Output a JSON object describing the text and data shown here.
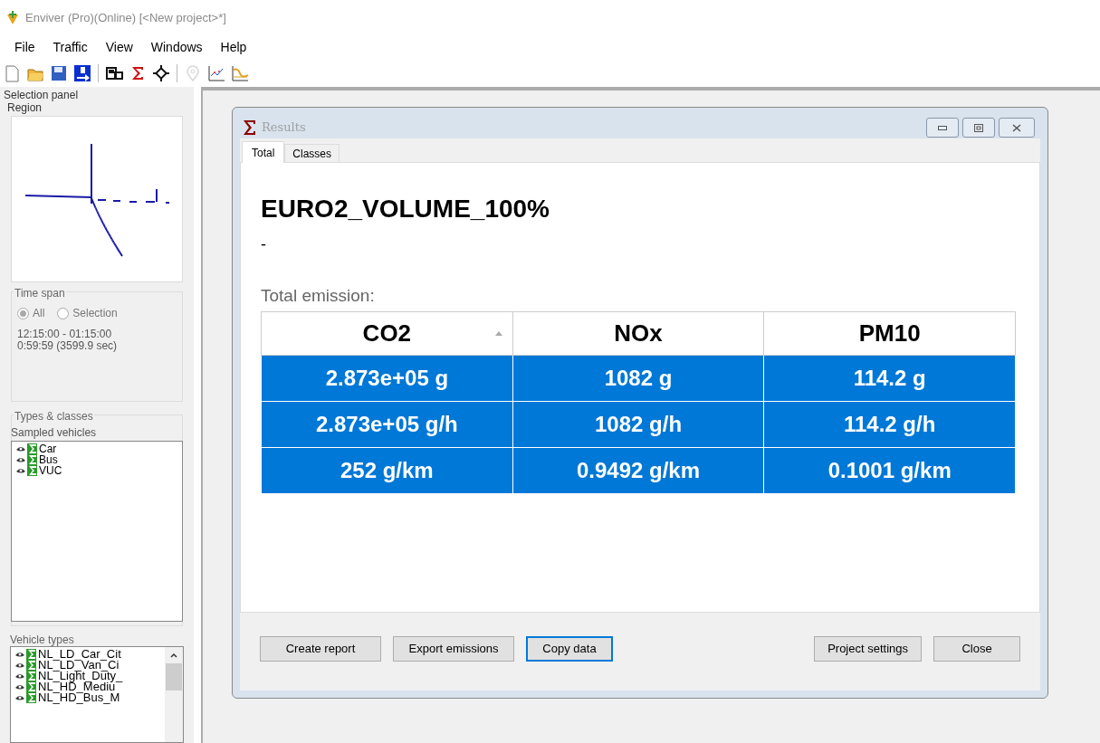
{
  "window": {
    "title": "Enviver (Pro)(Online) [<New project>*]"
  },
  "menu": [
    "File",
    "Traffic",
    "View",
    "Windows",
    "Help"
  ],
  "toolbar": [
    {
      "kind": "new",
      "disabled": false
    },
    {
      "kind": "open",
      "disabled": false
    },
    {
      "kind": "save",
      "disabled": false
    },
    {
      "kind": "import",
      "disabled": false
    },
    {
      "kind": "sep"
    },
    {
      "kind": "vehicles",
      "disabled": false
    },
    {
      "kind": "sigma",
      "disabled": false
    },
    {
      "kind": "junction",
      "disabled": false
    },
    {
      "kind": "sep"
    },
    {
      "kind": "pin",
      "disabled": true
    },
    {
      "kind": "chart1",
      "disabled": false
    },
    {
      "kind": "chart2",
      "disabled": false
    }
  ],
  "selection_panel": {
    "title": "Selection panel",
    "region": {
      "title": "Region"
    },
    "time_span": {
      "title": "Time span",
      "options": [
        {
          "label": "All",
          "selected": true
        },
        {
          "label": "Selection",
          "selected": false
        }
      ],
      "range": "12:15:00 - 01:15:00",
      "duration": "0:59:59 (3599.9 sec)"
    },
    "types_classes": {
      "title": "Types & classes",
      "sampled_label": "Sampled vehicles",
      "sampled": [
        "Car",
        "Bus",
        "VUC"
      ]
    },
    "vehicle_types": {
      "title": "Vehicle types",
      "items": [
        "NL_LD_Car_Cit",
        "NL_LD_Van_Ci",
        "NL_Light_Duty_",
        "NL_HD_Mediu",
        "NL_HD_Bus_M"
      ]
    }
  },
  "results": {
    "title": "Results",
    "tabs": [
      {
        "label": "Total",
        "selected": true
      },
      {
        "label": "Classes",
        "selected": false
      }
    ],
    "scenario": "EURO2_VOLUME_100%",
    "subtitle": "-",
    "section": "Total emission:",
    "table": {
      "columns": [
        {
          "label": "CO2",
          "sorted": true
        },
        {
          "label": "NOx",
          "sorted": false
        },
        {
          "label": "PM10",
          "sorted": false
        }
      ],
      "rows": [
        {
          "cells": [
            "2.873e+05 g",
            "1082 g",
            "114.2 g"
          ],
          "selected": true
        },
        {
          "cells": [
            "2.873e+05 g/h",
            "1082 g/h",
            "114.2 g/h"
          ],
          "selected": true
        },
        {
          "cells": [
            "252 g/km",
            "0.9492 g/km",
            "0.1001 g/km"
          ],
          "selected": true
        }
      ]
    },
    "buttons_left": [
      {
        "label": "Create report",
        "focused": false
      },
      {
        "label": "Export emissions",
        "focused": false
      },
      {
        "label": "Copy data",
        "focused": true
      }
    ],
    "buttons_right": [
      {
        "label": "Project settings",
        "focused": false
      },
      {
        "label": "Close",
        "focused": false
      }
    ]
  }
}
